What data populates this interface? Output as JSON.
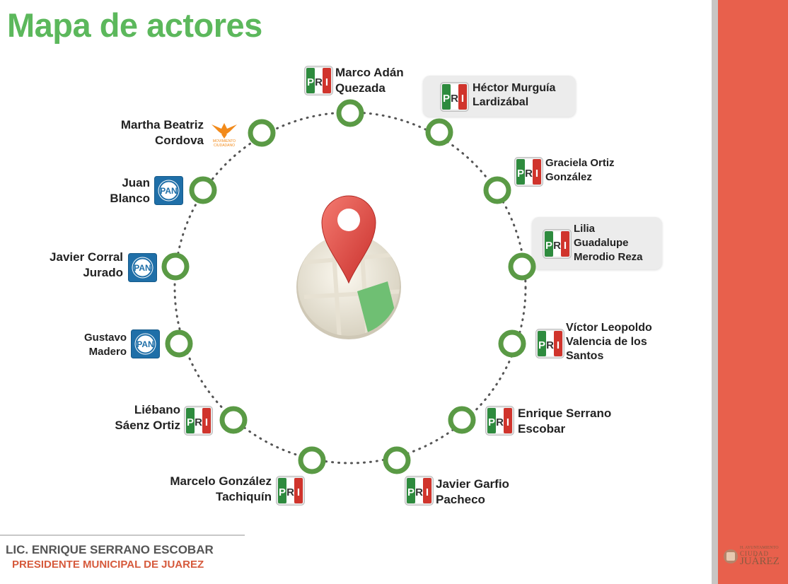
{
  "title": "Mapa de actores",
  "colors": {
    "accent": "#5cb85c",
    "ring": "#5a9a45",
    "pri_green": "#2e8b3e",
    "pri_red": "#d0342c",
    "pan_blue": "#1f6fa8",
    "mc_orange": "#f28a1a",
    "side_red": "#e8604c"
  },
  "actors": [
    {
      "id": "marco",
      "name": "Marco Adán Quezada",
      "lines": [
        "Marco Adán",
        "Quezada"
      ],
      "party": "PRI",
      "highlight": false
    },
    {
      "id": "hector",
      "name": "Héctor Murguía Lardizábal",
      "lines": [
        "Héctor Murguía",
        "Lardizábal"
      ],
      "party": "PRI",
      "highlight": true
    },
    {
      "id": "graciela",
      "name": "Graciela Ortiz González",
      "lines": [
        "Graciela Ortiz",
        "González"
      ],
      "party": "PRI",
      "highlight": false
    },
    {
      "id": "lilia",
      "name": "Lilia Guadalupe Merodio Reza",
      "lines": [
        "Lilia",
        "Guadalupe",
        "Merodio Reza"
      ],
      "party": "PRI",
      "highlight": true
    },
    {
      "id": "victor",
      "name": "Víctor Leopoldo Valencia de los Santos",
      "lines": [
        "Víctor Leopoldo",
        "Valencia de los",
        "Santos"
      ],
      "party": "PRI",
      "highlight": false
    },
    {
      "id": "enrique",
      "name": "Enrique Serrano Escobar",
      "lines": [
        "Enrique Serrano",
        "Escobar"
      ],
      "party": "PRI",
      "highlight": false
    },
    {
      "id": "javierg",
      "name": "Javier Garfio Pacheco",
      "lines": [
        "Javier Garfio",
        "Pacheco"
      ],
      "party": "PRI",
      "highlight": false
    },
    {
      "id": "marcelo",
      "name": "Marcelo González Tachiquín",
      "lines": [
        "Marcelo González",
        "Tachiquín"
      ],
      "party": "PRI",
      "highlight": false
    },
    {
      "id": "liebano",
      "name": "Liébano Sáenz Ortiz",
      "lines": [
        "Liébano",
        "Sáenz Ortiz"
      ],
      "party": "PRI",
      "highlight": false
    },
    {
      "id": "gustavo",
      "name": "Gustavo Madero",
      "lines": [
        "Gustavo",
        "Madero"
      ],
      "party": "PAN",
      "highlight": false
    },
    {
      "id": "javierc",
      "name": "Javier Corral Jurado",
      "lines": [
        "Javier Corral",
        "Jurado"
      ],
      "party": "PAN",
      "highlight": false
    },
    {
      "id": "juan",
      "name": "Juan Blanco",
      "lines": [
        "Juan",
        "Blanco"
      ],
      "party": "PAN",
      "highlight": false
    },
    {
      "id": "martha",
      "name": "Martha Beatriz Cordova",
      "lines": [
        "Martha Beatriz",
        "Cordova"
      ],
      "party": "Movimiento Ciudadano",
      "highlight": false
    }
  ],
  "party_logos": {
    "pri": {
      "letters": [
        "P",
        "R",
        "I"
      ]
    },
    "pan": {
      "text": "PAN"
    },
    "mc": {
      "lines": [
        "MOVIMIENTO",
        "CIUDADANO"
      ]
    }
  },
  "icons": {
    "center": "map-pin-icon"
  },
  "footer": {
    "name": "LIC. ENRIQUE SERRANO ESCOBAR",
    "role": "PRESIDENTE MUNICIPAL DE JUAREZ"
  },
  "brand": {
    "top": "H. AYUNTAMIENTO",
    "mid": "CIUDAD",
    "big": "JUÁREZ"
  }
}
